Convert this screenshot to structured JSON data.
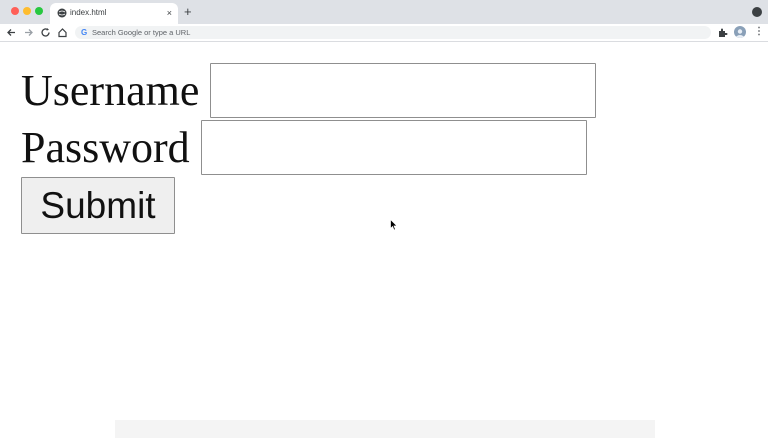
{
  "browser": {
    "tab_title": "index.html",
    "tab_close": "×",
    "new_tab": "+",
    "omnibox_placeholder": "Search Google or type a URL",
    "omnibox_g": "G",
    "menu": "⋮"
  },
  "form": {
    "username_label": "Username",
    "username_value": "",
    "password_label": "Password",
    "password_value": "",
    "submit_label": "Submit"
  }
}
